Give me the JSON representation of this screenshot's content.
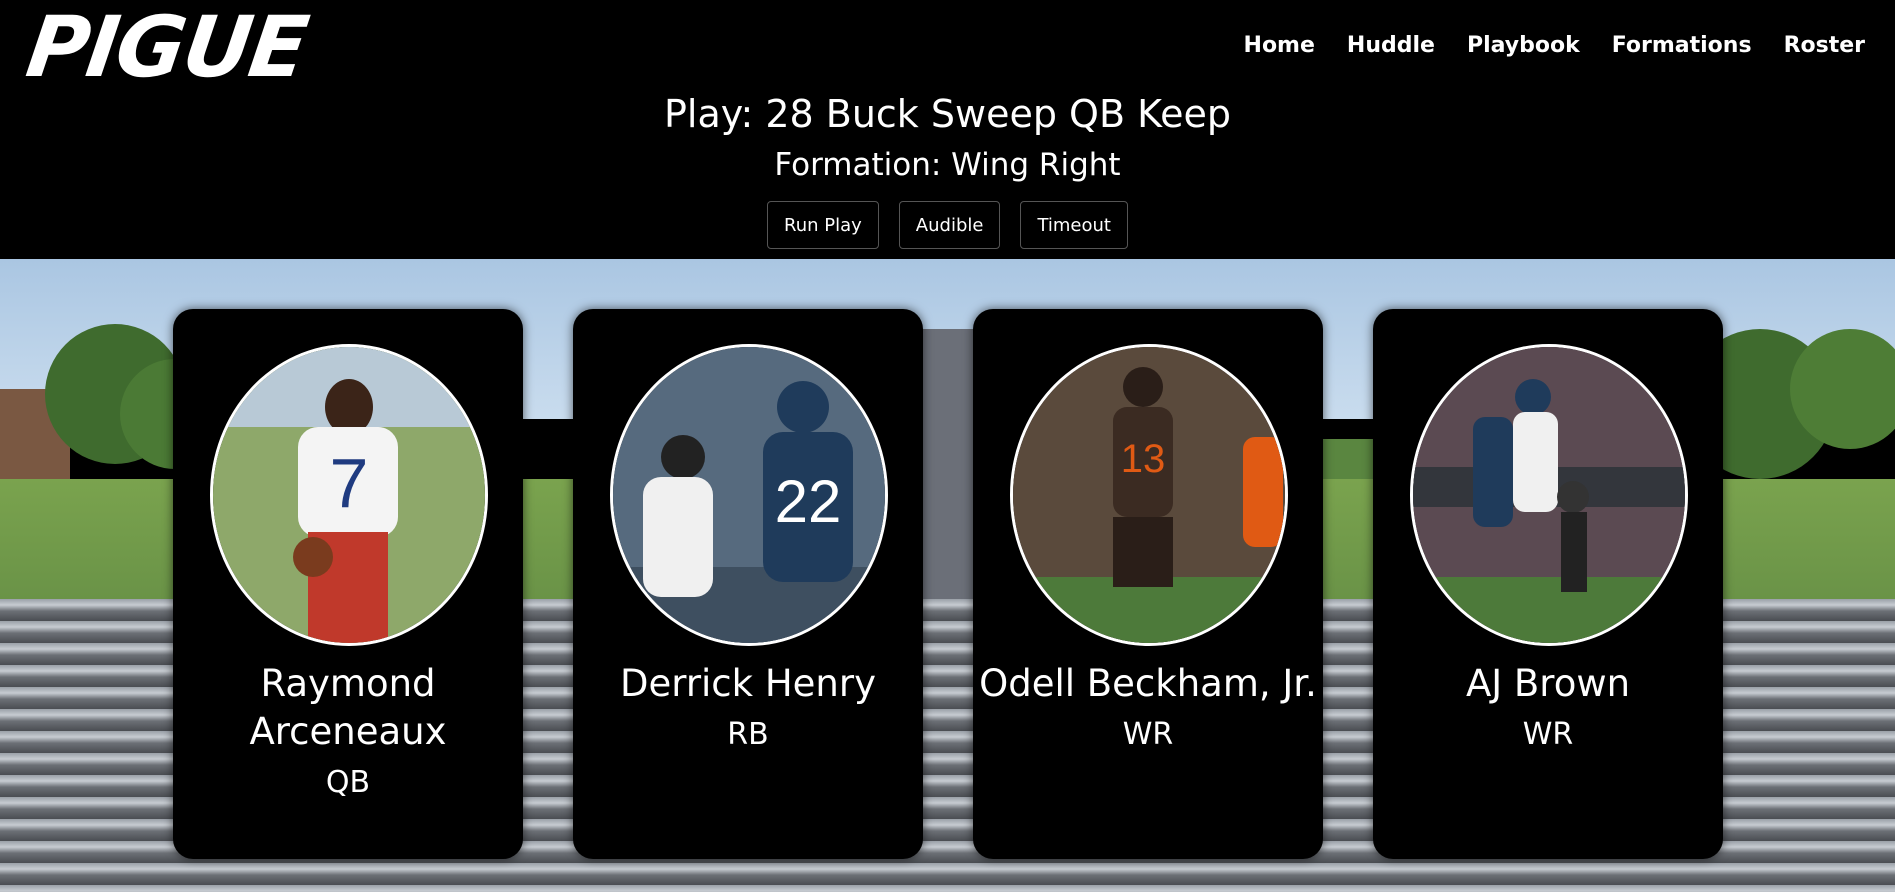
{
  "brand": {
    "logo_text": "PIGUE"
  },
  "nav": [
    "Home",
    "Huddle",
    "Playbook",
    "Formations",
    "Roster"
  ],
  "play": {
    "title": "Play: 28 Buck Sweep QB Keep",
    "formation": "Formation: Wing Right"
  },
  "controls": [
    "Run Play",
    "Audible",
    "Timeout"
  ],
  "players": [
    {
      "name": "Raymond Arceneaux",
      "position": "QB",
      "jersey_colors": [
        "#ffffff",
        "#c0392b"
      ]
    },
    {
      "name": "Derrick Henry",
      "position": "RB",
      "jersey_colors": [
        "#1f3b5b",
        "#ffffff"
      ]
    },
    {
      "name": "Odell Beckham, Jr.",
      "position": "WR",
      "jersey_colors": [
        "#3b2b22",
        "#e05a14"
      ]
    },
    {
      "name": "AJ Brown",
      "position": "WR",
      "jersey_colors": [
        "#ffffff",
        "#1f3b5b"
      ]
    }
  ]
}
